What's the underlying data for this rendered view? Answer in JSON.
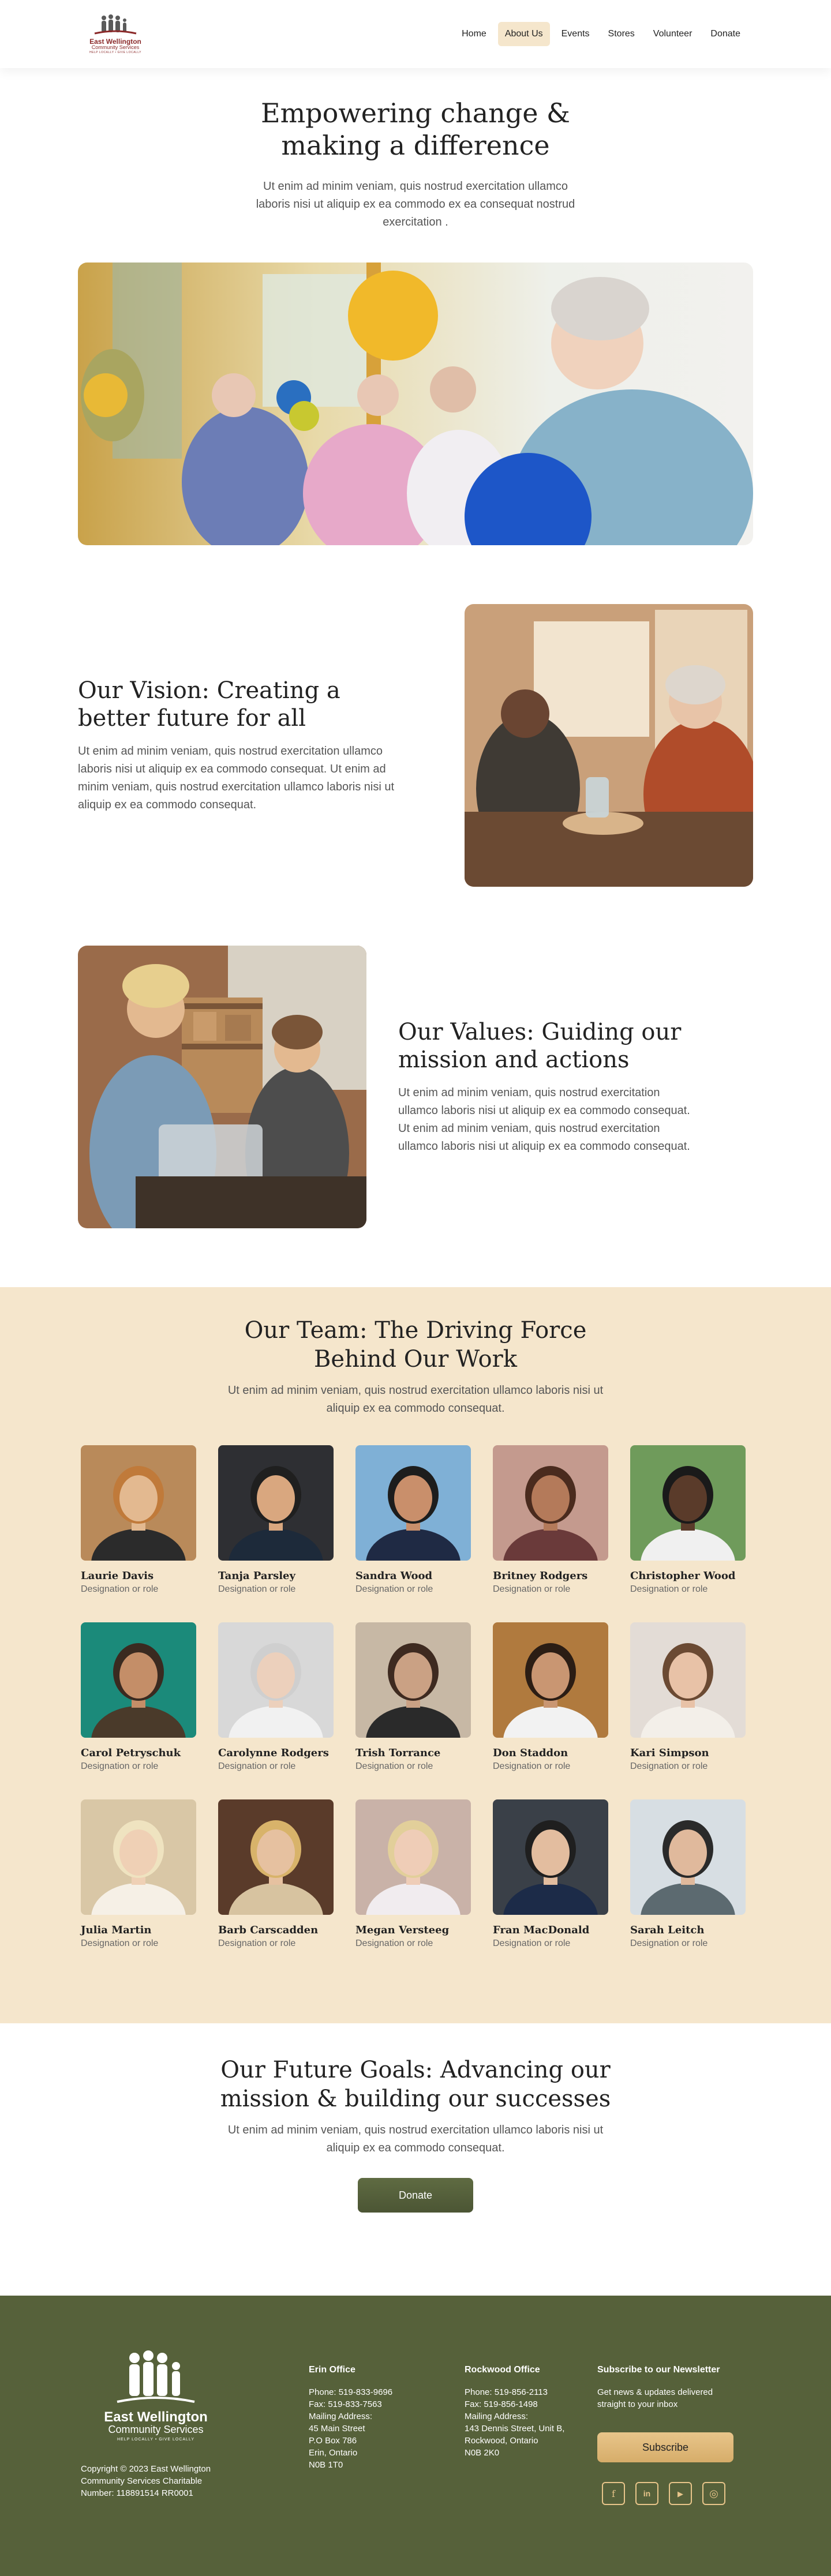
{
  "header": {
    "logo": {
      "name": "East Wellington",
      "sub": "Community Services",
      "tag": "HELP LOCALLY • GIVE LOCALLY"
    },
    "nav": [
      {
        "label": "Home"
      },
      {
        "label": "About Us"
      },
      {
        "label": "Events"
      },
      {
        "label": "Stores"
      },
      {
        "label": "Volunteer"
      },
      {
        "label": "Donate"
      }
    ]
  },
  "hero": {
    "title": "Empowering change & making a difference",
    "text": "Ut enim ad minim veniam, quis nostrud exercitation ullamco laboris nisi ut aliquip ex ea commodo ex ea consequat nostrud exercitation ."
  },
  "vision": {
    "title": "Our Vision: Creating a better future for all",
    "text": "Ut enim ad minim veniam, quis nostrud exercitation ullamco laboris nisi ut aliquip ex ea commodo consequat. Ut enim ad minim veniam, quis nostrud exercitation ullamco laboris nisi ut aliquip ex ea commodo consequat."
  },
  "values": {
    "title": "Our Values: Guiding our mission and actions",
    "text": "Ut enim ad minim veniam, quis nostrud exercitation ullamco laboris nisi ut aliquip ex ea commodo consequat. Ut enim ad minim veniam, quis nostrud exercitation ullamco laboris nisi ut aliquip ex ea commodo consequat."
  },
  "team": {
    "title": "Our Team: The Driving Force Behind Our Work",
    "text": "Ut enim ad minim veniam, quis nostrud exercitation ullamco laboris nisi ut aliquip ex ea commodo consequat.",
    "members": [
      {
        "name": "Laurie Davis",
        "role": "Designation or role"
      },
      {
        "name": "Tanja Parsley",
        "role": "Designation or role"
      },
      {
        "name": "Sandra Wood",
        "role": "Designation or role"
      },
      {
        "name": "Britney Rodgers",
        "role": "Designation or role"
      },
      {
        "name": "Christopher Wood",
        "role": "Designation or role"
      },
      {
        "name": "Carol Petryschuk",
        "role": "Designation or role"
      },
      {
        "name": "Carolynne Rodgers",
        "role": "Designation or role"
      },
      {
        "name": "Trish Torrance",
        "role": "Designation or role"
      },
      {
        "name": "Don Staddon",
        "role": "Designation or role"
      },
      {
        "name": "Kari Simpson",
        "role": "Designation or role"
      },
      {
        "name": "Julia Martin",
        "role": "Designation or role"
      },
      {
        "name": "Barb Carscadden",
        "role": "Designation or role"
      },
      {
        "name": "Megan Versteeg",
        "role": "Designation or role"
      },
      {
        "name": "Fran MacDonald",
        "role": "Designation or role"
      },
      {
        "name": "Sarah Leitch",
        "role": "Designation or role"
      }
    ]
  },
  "goals": {
    "title": "Our Future Goals: Advancing our mission & building our successes",
    "text": "Ut enim ad minim veniam, quis nostrud exercitation ullamco laboris nisi ut aliquip ex ea commodo consequat.",
    "button": "Donate"
  },
  "footer": {
    "logo": {
      "name": "East Wellington",
      "sub": "Community Services",
      "tag": "HELP LOCALLY • GIVE LOCALLY"
    },
    "copyright": "Copyright © 2023 East Wellington Community Services Charitable Number: 118891514 RR0001",
    "erin": {
      "title": "Erin Office",
      "lines": [
        "Phone: 519-833-9696",
        "Fax: 519-833-7563",
        "Mailing Address:",
        "45 Main Street",
        "P.O Box 786",
        "Erin, Ontario",
        "N0B 1T0"
      ]
    },
    "rockwood": {
      "title": "Rockwood Office",
      "lines": [
        "Phone: 519-856-2113",
        "Fax: 519-856-1498",
        "Mailing Address:",
        "143 Dennis Street, Unit B,",
        "Rockwood, Ontario",
        "N0B 2K0"
      ]
    },
    "newsletter": {
      "title": "Subscribe to our Newsletter",
      "text": "Get news & updates delivered straight to your inbox",
      "button": "Subscribe"
    },
    "socials": [
      {
        "icon": "facebook-icon",
        "glyph": "f"
      },
      {
        "icon": "linkedin-icon",
        "glyph": "in"
      },
      {
        "icon": "youtube-icon",
        "glyph": "▶"
      },
      {
        "icon": "instagram-icon",
        "glyph": "◎"
      }
    ]
  },
  "colors": {
    "accent": "#f5e6cc",
    "footer": "#56613a",
    "button": "#56613a",
    "gold": "#e8c58a"
  }
}
